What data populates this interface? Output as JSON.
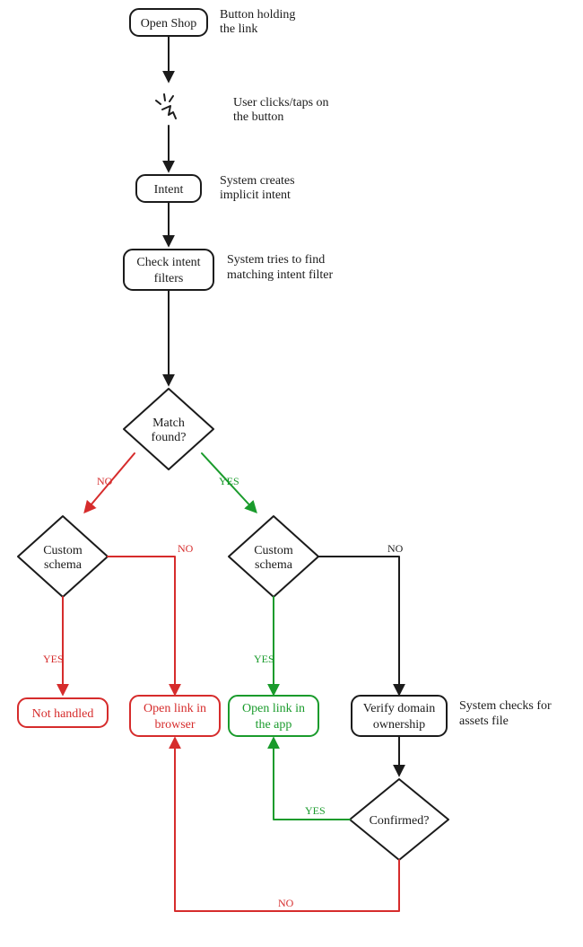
{
  "nodes": {
    "open_shop": "Open Shop",
    "intent": "Intent",
    "check_filters_l1": "Check intent",
    "check_filters_l2": "filters",
    "match_found_l1": "Match",
    "match_found_l2": "found?",
    "custom_schema_left_l1": "Custom",
    "custom_schema_left_l2": "schema",
    "custom_schema_right_l1": "Custom",
    "custom_schema_right_l2": "schema",
    "not_handled": "Not handled",
    "open_browser_l1": "Open link in",
    "open_browser_l2": "browser",
    "open_app_l1": "Open link in",
    "open_app_l2": "the app",
    "verify_domain_l1": "Verify domain",
    "verify_domain_l2": "ownership",
    "confirmed": "Confirmed?"
  },
  "annotations": {
    "open_shop_l1": "Button holding",
    "open_shop_l2": "the link",
    "click_l1": "User clicks/taps on",
    "click_l2": "the button",
    "intent_l1": "System creates",
    "intent_l2": "implicit intent",
    "check_l1": "System tries to find",
    "check_l2": "matching intent filter",
    "verify_l1": "System checks for",
    "verify_l2": "assets file"
  },
  "edge_labels": {
    "no": "NO",
    "yes": "YES"
  },
  "chart_data": {
    "type": "flowchart",
    "title": "Android implicit intent / deep-link resolution flow",
    "nodes": [
      {
        "id": "open_shop",
        "label": "Open Shop",
        "kind": "action-box",
        "note": "Button holding the link"
      },
      {
        "id": "click",
        "label": "(click icon)",
        "kind": "event",
        "note": "User clicks/taps on the button"
      },
      {
        "id": "intent",
        "label": "Intent",
        "kind": "action-box",
        "note": "System creates implicit intent"
      },
      {
        "id": "check_filters",
        "label": "Check intent filters",
        "kind": "action-box",
        "note": "System tries to find matching intent filter"
      },
      {
        "id": "match_found",
        "label": "Match found?",
        "kind": "decision"
      },
      {
        "id": "custom_schema_no",
        "label": "Custom schema",
        "kind": "decision"
      },
      {
        "id": "custom_schema_yes",
        "label": "Custom schema",
        "kind": "decision"
      },
      {
        "id": "not_handled",
        "label": "Not handled",
        "kind": "terminal",
        "color": "red"
      },
      {
        "id": "open_browser",
        "label": "Open link in browser",
        "kind": "terminal",
        "color": "red"
      },
      {
        "id": "open_app",
        "label": "Open link in the app",
        "kind": "terminal",
        "color": "green"
      },
      {
        "id": "verify_domain",
        "label": "Verify domain ownership",
        "kind": "action-box",
        "note": "System checks for assets file"
      },
      {
        "id": "confirmed",
        "label": "Confirmed?",
        "kind": "decision"
      }
    ],
    "edges": [
      {
        "from": "open_shop",
        "to": "click"
      },
      {
        "from": "click",
        "to": "intent"
      },
      {
        "from": "intent",
        "to": "check_filters"
      },
      {
        "from": "check_filters",
        "to": "match_found"
      },
      {
        "from": "match_found",
        "to": "custom_schema_no",
        "label": "NO",
        "color": "red"
      },
      {
        "from": "match_found",
        "to": "custom_schema_yes",
        "label": "YES",
        "color": "green"
      },
      {
        "from": "custom_schema_no",
        "to": "not_handled",
        "label": "YES",
        "color": "red"
      },
      {
        "from": "custom_schema_no",
        "to": "open_browser",
        "label": "NO",
        "color": "red"
      },
      {
        "from": "custom_schema_yes",
        "to": "open_app",
        "label": "YES",
        "color": "green"
      },
      {
        "from": "custom_schema_yes",
        "to": "verify_domain",
        "label": "NO"
      },
      {
        "from": "verify_domain",
        "to": "confirmed"
      },
      {
        "from": "confirmed",
        "to": "open_app",
        "label": "YES",
        "color": "green"
      },
      {
        "from": "confirmed",
        "to": "open_browser",
        "label": "NO",
        "color": "red"
      }
    ]
  }
}
